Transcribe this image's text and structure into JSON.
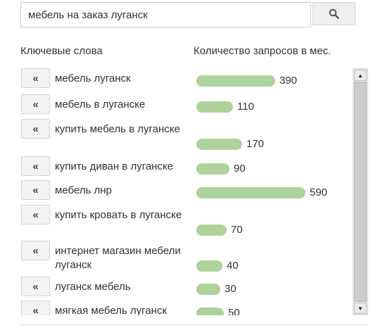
{
  "search": {
    "value": "мебель на заказ луганск",
    "icon": "search-icon"
  },
  "table": {
    "headers": {
      "keywords": "Ключевые слова",
      "count": "Количество запросов в мес."
    },
    "add_button_label": "«",
    "max_count": 590,
    "rows": [
      {
        "keyword": "мебель луганск",
        "count": 390
      },
      {
        "keyword": "мебель в луганске",
        "count": 110
      },
      {
        "keyword": "купить мебель в луганске",
        "count": 170
      },
      {
        "keyword": "купить диван в луганске",
        "count": 90
      },
      {
        "keyword": "мебель лнр",
        "count": 590
      },
      {
        "keyword": "купить кровать в луганске",
        "count": 70
      },
      {
        "keyword": "интернет магазин мебели луганск",
        "count": 40
      },
      {
        "keyword": "луганск мебель",
        "count": 30
      },
      {
        "keyword": "мягкая мебель луганск",
        "count": 50
      }
    ]
  },
  "colors": {
    "bar": "#add39a"
  },
  "scrollbar": {
    "up_icon": "arrow-up-icon",
    "down_icon": "arrow-down-icon"
  }
}
